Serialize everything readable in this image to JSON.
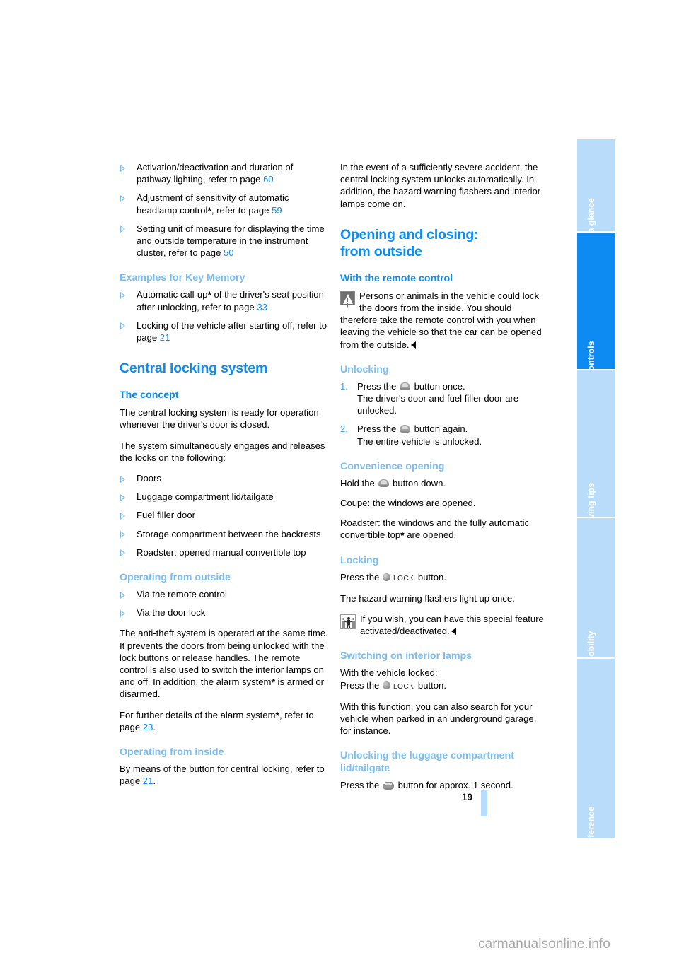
{
  "page_number": "19",
  "watermark": "carmanualsonline.info",
  "colors": {
    "accent_strong": "#0d8bf2",
    "accent_light": "#79bdf4",
    "tab_inactive": "#b9dcfb",
    "tab_active": "#0d8bf2"
  },
  "tabs": [
    {
      "label": "At a glance",
      "active": false
    },
    {
      "label": "Controls",
      "active": true
    },
    {
      "label": "Driving tips",
      "active": false
    },
    {
      "label": "Mobility",
      "active": false
    },
    {
      "label": "Reference",
      "active": false
    }
  ],
  "left_column": {
    "top_bullets": [
      {
        "pre": "Activation/deactivation and duration of pathway lighting, refer to page ",
        "ref": "60",
        "post": ""
      },
      {
        "pre": "Adjustment of sensitivity of automatic headlamp control",
        "asterisk": "*",
        "mid": ", refer to page ",
        "ref": "59",
        "post": ""
      },
      {
        "pre": "Setting unit of measure for displaying the time and outside temperature in the instrument cluster, refer to page ",
        "ref": "50",
        "post": ""
      }
    ],
    "key_memory": {
      "heading": "Examples for Key Memory",
      "bullets": [
        {
          "pre": "Automatic call-up",
          "asterisk": "*",
          "mid": " of the driver's seat position after unlocking, refer to page ",
          "ref": "33",
          "post": ""
        },
        {
          "pre": "Locking of the vehicle after starting off, refer to page ",
          "ref": "21",
          "post": ""
        }
      ]
    },
    "central_locking": {
      "heading": "Central locking system",
      "concept_heading": "The concept",
      "concept_p1": "The central locking system is ready for operation whenever the driver's door is closed.",
      "concept_p2": "The system simultaneously engages and releases the locks on the following:",
      "concept_bullets": [
        "Doors",
        "Luggage compartment lid/tailgate",
        "Fuel filler door",
        "Storage compartment between the backrests",
        "Roadster: opened manual convertible top"
      ],
      "outside_heading": "Operating from outside",
      "outside_bullets": [
        "Via the remote control",
        "Via the door lock"
      ],
      "outside_p1_a": "The anti-theft system is operated at the same time. It prevents the doors from being unlocked with the lock buttons or release handles. The remote control is also used to switch the interior lamps on and off. In addition, the alarm system",
      "outside_p1_ast": "*",
      "outside_p1_b": " is armed or disarmed.",
      "outside_p2_a": "For further details of the alarm system",
      "outside_p2_ast": "*",
      "outside_p2_b": ", refer to page ",
      "outside_p2_ref": "23",
      "outside_p2_c": ".",
      "inside_heading": "Operating from inside",
      "inside_p1_a": "By means of the button for central locking, refer to page ",
      "inside_p1_ref": "21",
      "inside_p1_b": "."
    }
  },
  "right_column": {
    "intro_p": "In the event of a sufficiently severe accident, the central locking system unlocks automatically. In addition, the hazard warning flashers and interior lamps come on.",
    "opening_closing": {
      "heading_line1": "Opening and closing:",
      "heading_line2": "from outside",
      "remote_heading": "With the remote control",
      "warning_text": "Persons or animals in the vehicle could lock the doors from the inside. You should therefore take the remote control with you when leaving the vehicle so that the car can be opened from the outside.",
      "warning_icon": "warning-triangle-icon",
      "unlocking_heading": "Unlocking",
      "unlocking_steps": [
        {
          "num": "1.",
          "pre": "Press the ",
          "icon": "remote-unlock-button-icon",
          "post": " button once.",
          "sub": "The driver's door and fuel filler door are unlocked."
        },
        {
          "num": "2.",
          "pre": "Press the ",
          "icon": "remote-unlock-button-icon",
          "post": " button again.",
          "sub": "The entire vehicle is unlocked."
        }
      ],
      "convenience_heading": "Convenience opening",
      "convenience_p1_a": "Hold the ",
      "convenience_p1_b": " button down.",
      "convenience_p2": "Coupe: the windows are opened.",
      "convenience_p3_a": "Roadster: the windows and the fully automatic convertible top",
      "convenience_p3_ast": "*",
      "convenience_p3_b": " are opened.",
      "locking_heading": "Locking",
      "locking_p1_a": "Press the ",
      "locking_lockword": "LOCK",
      "locking_p1_b": " button.",
      "locking_p2": "The hazard warning flashers light up once.",
      "locking_note": "If you wish, you can have this special feature activated/deactivated.",
      "locking_note_icon": "special-feature-people-icon",
      "interior_heading": "Switching on interior lamps",
      "interior_p1": "With the vehicle locked:",
      "interior_p2_a": "Press the ",
      "interior_p2_b": " button.",
      "interior_p3": "With this function, you can also search for your vehicle when parked in an underground garage, for instance.",
      "luggage_heading_line1": "Unlocking the luggage compartment",
      "luggage_heading_line2": "lid/tailgate",
      "luggage_p1_a": "Press the ",
      "luggage_p1_b": " button for approx. 1 second."
    }
  }
}
